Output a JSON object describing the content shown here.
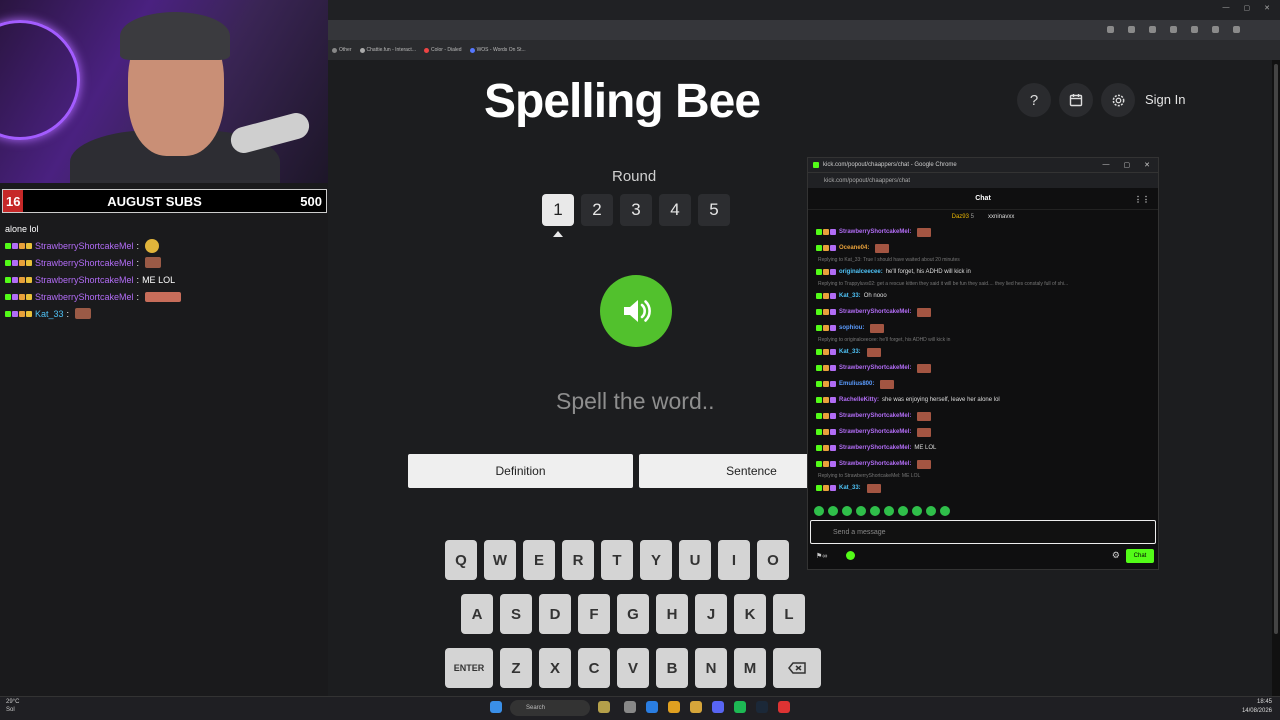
{
  "browser": {
    "bookmarks": [
      "Other",
      "Chattie.fun - Interact...",
      "Color - Dialed",
      "WOS - Words On St..."
    ]
  },
  "app": {
    "title": "Spelling Bee",
    "help_icon": "?",
    "signin_label": "Sign In",
    "round_label": "Round",
    "rounds": [
      "1",
      "2",
      "3",
      "4",
      "5"
    ],
    "active_round": "1",
    "prompt": "Spell the word..",
    "definition_label": "Definition",
    "sentence_label": "Sentence",
    "keyboard": {
      "row1": [
        "Q",
        "W",
        "E",
        "R",
        "T",
        "Y",
        "U",
        "I",
        "O"
      ],
      "row2": [
        "A",
        "S",
        "D",
        "F",
        "G",
        "H",
        "J",
        "K",
        "L"
      ],
      "row3": [
        "ENTER",
        "Z",
        "X",
        "C",
        "V",
        "B",
        "N",
        "M"
      ],
      "backspace_icon": "backspace-icon"
    }
  },
  "stream_overlay": {
    "subs_current": "16",
    "subs_title": "AUGUST SUBS",
    "subs_goal": "500",
    "top_text": "alone lol",
    "chat": [
      {
        "user": "StrawberryShortcakeMel",
        "sep": " :",
        "text": "",
        "emote": "round"
      },
      {
        "user": "StrawberryShortcakeMel",
        "sep": " :",
        "text": "",
        "emote": "normal"
      },
      {
        "user": "StrawberryShortcakeMel",
        "sep": " :",
        "text": "ME LOL",
        "emote": ""
      },
      {
        "user": "StrawberryShortcakeMel",
        "sep": " :",
        "text": "",
        "emote": "wide"
      },
      {
        "user": "Kat_33",
        "sep": " :",
        "text": "",
        "emote": "normal"
      }
    ]
  },
  "popout": {
    "window_title": "kick.com/popout/chaappers/chat - Google Chrome",
    "url": "kick.com/popout/chaappers/chat",
    "header": "Chat",
    "pinned": [
      {
        "name": "Daz93",
        "count": "5"
      },
      {
        "name": "xxninavxx",
        "count": ""
      }
    ],
    "messages": [
      {
        "type": "msg",
        "user": "StrawberryShortcakeMel:",
        "color": "#b16cf5",
        "text": ""
      },
      {
        "type": "msg",
        "user": "Oceane04:",
        "color": "#e8a13a",
        "text": ""
      },
      {
        "type": "reply",
        "text": "Replying to Kat_33: True I should have waited about 20 minutes"
      },
      {
        "type": "msg",
        "user": "originalceecee:",
        "color": "#4fc3f7",
        "text": "he'll forget, his ADHD will kick in"
      },
      {
        "type": "reply",
        "text": "Replying to Trappyluvs02: get a rescue kitten they said it will be fun they said.... they lied hes constaly full of shi..."
      },
      {
        "type": "msg",
        "user": "Kat_33:",
        "color": "#4fc3f7",
        "text": "Oh nooo"
      },
      {
        "type": "msg",
        "user": "StrawberryShortcakeMel:",
        "color": "#b16cf5",
        "text": ""
      },
      {
        "type": "msg",
        "user": "sophiou:",
        "color": "#5b9cff",
        "text": ""
      },
      {
        "type": "reply",
        "text": "Replying to originalceecee: he'll forget, his ADHD will kick in"
      },
      {
        "type": "msg",
        "user": "Kat_33:",
        "color": "#4fc3f7",
        "text": ""
      },
      {
        "type": "msg",
        "user": "StrawberryShortcakeMel:",
        "color": "#b16cf5",
        "text": ""
      },
      {
        "type": "msg",
        "user": "Emulius800:",
        "color": "#5b9cff",
        "text": ""
      },
      {
        "type": "msg",
        "user": "RachelleKitty:",
        "color": "#b16cf5",
        "text": "she was enjoying herself, leave her alone lol"
      },
      {
        "type": "msg",
        "user": "StrawberryShortcakeMel:",
        "color": "#b16cf5",
        "text": ""
      },
      {
        "type": "msg",
        "user": "StrawberryShortcakeMel:",
        "color": "#b16cf5",
        "text": ""
      },
      {
        "type": "msg",
        "user": "StrawberryShortcakeMel:",
        "color": "#b16cf5",
        "text": "ME LOL"
      },
      {
        "type": "msg",
        "user": "StrawberryShortcakeMel:",
        "color": "#b16cf5",
        "text": ""
      },
      {
        "type": "reply",
        "text": "Replying to StrawberryShortcakeMel: ME LOL"
      },
      {
        "type": "msg",
        "user": "Kat_33:",
        "color": "#4fc3f7",
        "text": ""
      }
    ],
    "input_placeholder": "Send a message",
    "send_label": "Chat"
  },
  "taskbar": {
    "weather_temp": "29°C",
    "weather_desc": "Sol",
    "search_placeholder": "Search",
    "time": "18:45",
    "date": "14/08/2026"
  }
}
